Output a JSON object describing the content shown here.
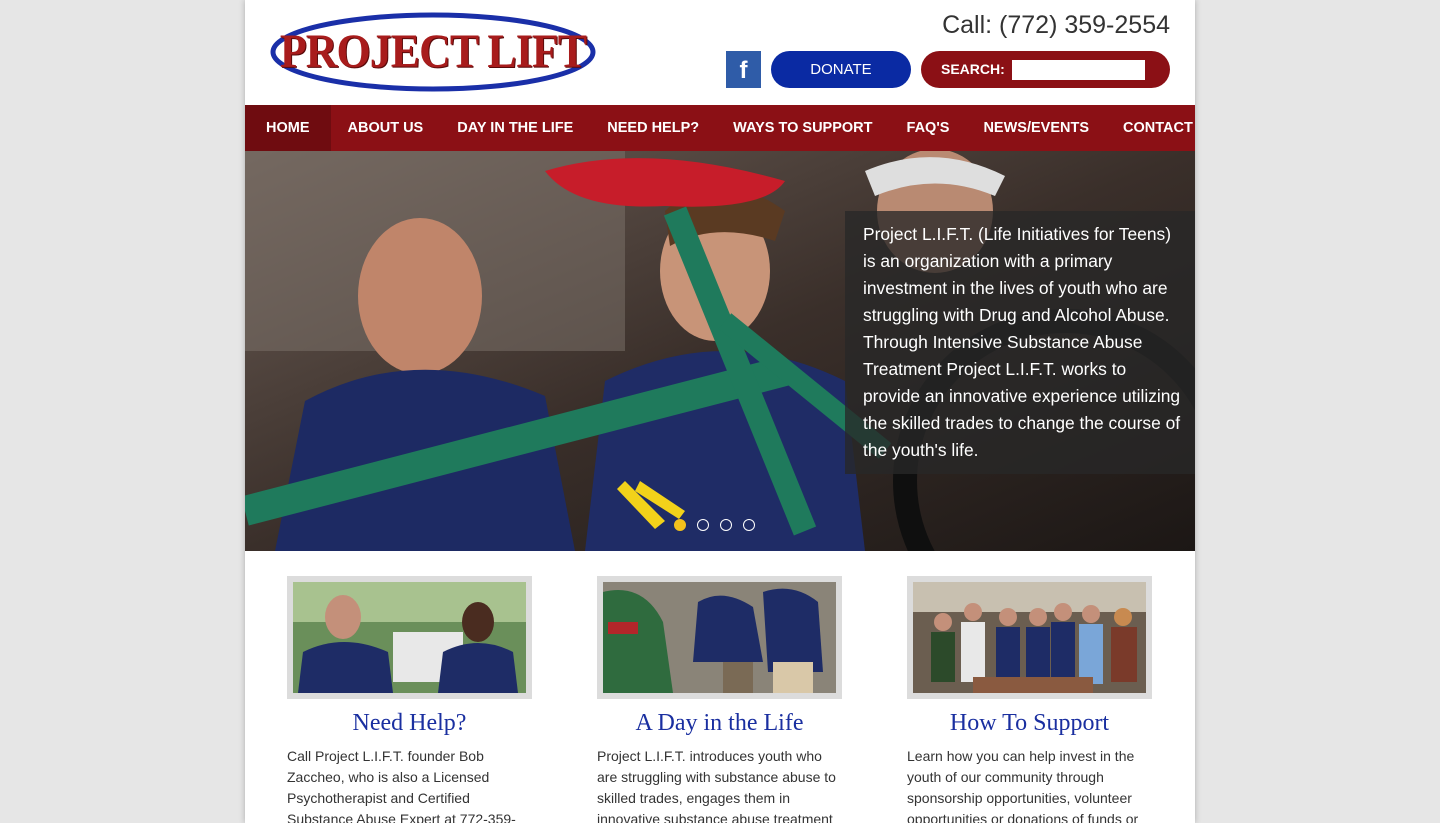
{
  "header": {
    "logo_text": "PROJECT LIFT",
    "phone": "Call: (772) 359-2554",
    "facebook_glyph": "f",
    "donate_label": "DONATE",
    "search_label": "SEARCH:",
    "search_value": ""
  },
  "nav": {
    "items": [
      {
        "label": "HOME"
      },
      {
        "label": "ABOUT US"
      },
      {
        "label": "DAY IN THE LIFE"
      },
      {
        "label": "NEED HELP?"
      },
      {
        "label": "WAYS TO SUPPORT"
      },
      {
        "label": "FAQ'S"
      },
      {
        "label": "NEWS/EVENTS"
      },
      {
        "label": "CONTACT"
      }
    ],
    "active_index": 0
  },
  "hero": {
    "caption": "Project L.I.F.T. (Life Initiatives for Teens) is an organization with a primary investment in the lives of youth who are struggling with Drug and Alcohol Abuse. Through Intensive Substance Abuse Treatment Project L.I.F.T. works to provide an innovative experience utilizing the skilled trades to change the course of the youth's life.",
    "slide_count": 4,
    "active_slide": 0
  },
  "columns": [
    {
      "title": "Need Help?",
      "text": "Call Project L.I.F.T. founder Bob Zaccheo, who is also a Licensed Psychotherapist and Certified Substance Abuse Expert at 772-359-"
    },
    {
      "title": "A Day in the Life",
      "text": "Project L.I.F.T. introduces youth who are struggling with substance abuse to skilled trades, engages them in innovative substance abuse treatment"
    },
    {
      "title": "How To Support",
      "text": "Learn how you can help invest in the youth of our community through sponsorship opportunities, volunteer opportunities or donations of funds or"
    }
  ],
  "colors": {
    "brand_red": "#8b1015",
    "brand_blue": "#0a2aa3",
    "title_blue": "#1a2fa0",
    "dot_active": "#f2c01c"
  }
}
